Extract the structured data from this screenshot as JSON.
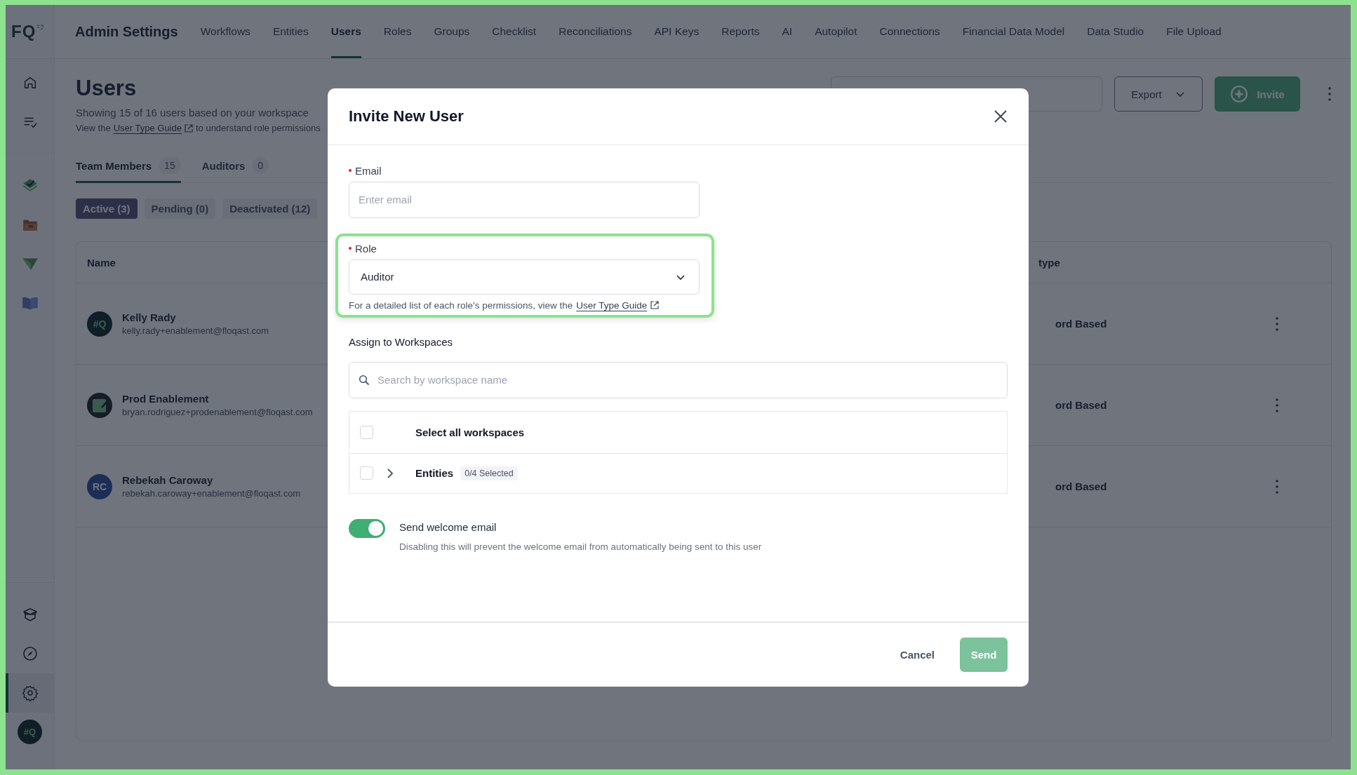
{
  "logo": {
    "text": "FQ"
  },
  "topbar": {
    "title": "Admin Settings",
    "nav": [
      {
        "label": "Workflows",
        "selected": false
      },
      {
        "label": "Entities",
        "selected": false
      },
      {
        "label": "Users",
        "selected": true
      },
      {
        "label": "Roles",
        "selected": false
      },
      {
        "label": "Groups",
        "selected": false
      },
      {
        "label": "Checklist",
        "selected": false
      },
      {
        "label": "Reconciliations",
        "selected": false
      },
      {
        "label": "API Keys",
        "selected": false
      },
      {
        "label": "Reports",
        "selected": false
      },
      {
        "label": "AI",
        "selected": false
      },
      {
        "label": "Autopilot",
        "selected": false
      },
      {
        "label": "Connections",
        "selected": false
      },
      {
        "label": "Financial Data Model",
        "selected": false
      },
      {
        "label": "Data Studio",
        "selected": false
      },
      {
        "label": "File Upload",
        "selected": false
      }
    ]
  },
  "sidebar": {
    "top_items": [
      {
        "kind": "home",
        "selected": false
      },
      {
        "kind": "tasks",
        "selected": false
      }
    ],
    "main_items": [
      {
        "kind": "stack",
        "selected": false
      },
      {
        "kind": "folder",
        "selected": false
      },
      {
        "kind": "plane",
        "selected": false
      },
      {
        "kind": "book",
        "selected": false
      }
    ],
    "bottom_items": [
      {
        "kind": "box",
        "selected": false
      },
      {
        "kind": "compass",
        "selected": false
      },
      {
        "kind": "settings",
        "selected": true
      }
    ],
    "avatar": "#Q"
  },
  "page": {
    "title": "Users",
    "subtitle": "Showing 15 of 16 users based on your workspace",
    "guide": {
      "before": "View the",
      "link": "User Type Guide",
      "after": "to understand role permissions"
    },
    "export_button": "Export",
    "invite_button": "Invite",
    "tabs": [
      {
        "label": "Team Members",
        "count": "15",
        "selected": true
      },
      {
        "label": "Auditors",
        "count": "0",
        "selected": false
      }
    ],
    "filters": [
      {
        "label": "Active (3)",
        "selected": true
      },
      {
        "label": "Pending (0)",
        "selected": false
      },
      {
        "label": "Deactivated (12)",
        "selected": false
      }
    ],
    "table": {
      "columns": [
        "Name",
        "type"
      ],
      "rows": [
        {
          "avatar": {
            "kind": "logo",
            "text": "#Q"
          },
          "name": "Kelly Rady",
          "email": "kelly.rady+enablement@floqast.com",
          "login_type": "ord Based"
        },
        {
          "avatar": {
            "kind": "image"
          },
          "name": "Prod Enablement",
          "email": "bryan.rodriguez+prodenablement@floqast.com",
          "login_type": "ord Based"
        },
        {
          "avatar": {
            "kind": "initials",
            "text": "RC"
          },
          "name": "Rebekah Caroway",
          "email": "rebekah.caroway+enablement@floqast.com",
          "login_type": "ord Based"
        }
      ]
    }
  },
  "modal": {
    "title": "Invite New User",
    "email": {
      "label": "Email",
      "required": true,
      "placeholder": "Enter email"
    },
    "role": {
      "label": "Role",
      "required": true,
      "value": "Auditor",
      "highlighted": true,
      "hint": "For a detailed list of each role's permissions, view the",
      "link": "User Type Guide"
    },
    "workspaces": {
      "label": "Assign to Workspaces",
      "placeholder": "Search by workspace name",
      "rows": [
        {
          "kind": "all",
          "label": "Select all workspaces",
          "checked": false
        },
        {
          "kind": "group",
          "label": "Entities",
          "badge": "0/4 Selected",
          "checked": false,
          "expanded": false
        }
      ]
    },
    "welcome": {
      "on": true,
      "label": "Send welcome email",
      "description": "Disabling this will prevent the welcome email from automatically being sent to this user"
    },
    "cancel_button": "Cancel",
    "send_button": {
      "label": "Send",
      "disabled": true
    }
  }
}
